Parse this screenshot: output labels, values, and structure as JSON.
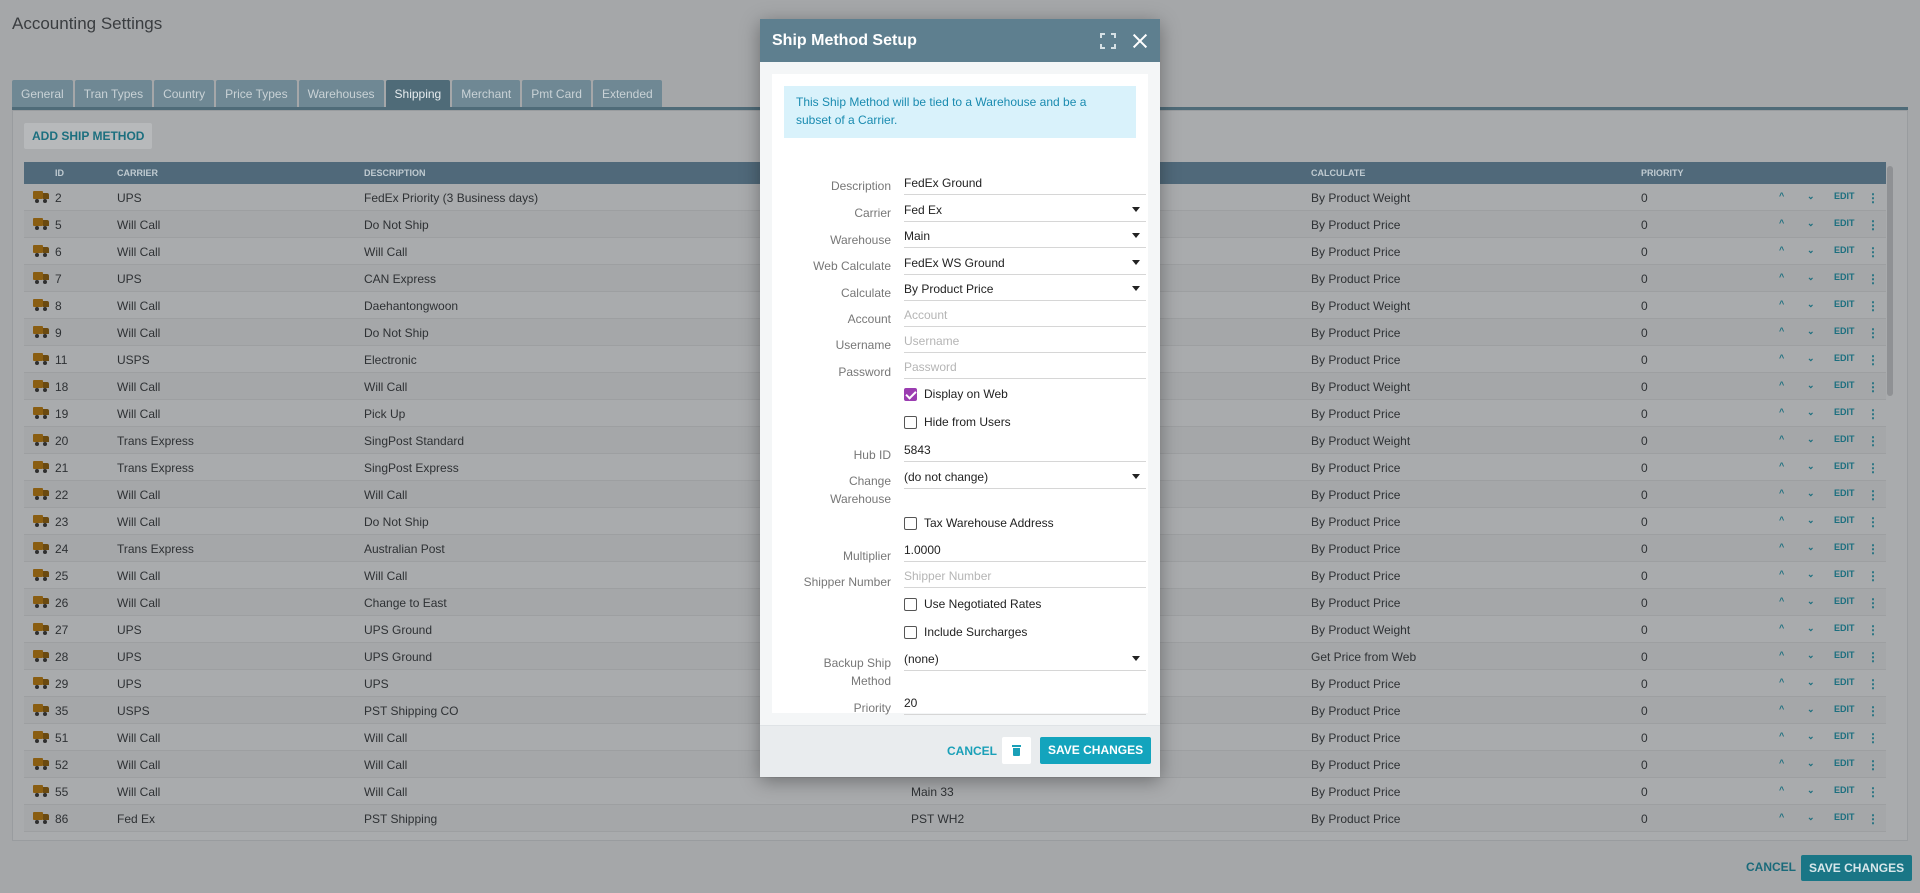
{
  "page": {
    "title": "Accounting Settings",
    "tabs": [
      "General",
      "Tran Types",
      "Country",
      "Price Types",
      "Warehouses",
      "Shipping",
      "Merchant",
      "Pmt Card",
      "Extended"
    ],
    "active_tab": "Shipping",
    "add_button": "ADD SHIP METHOD",
    "columns": {
      "id": "ID",
      "carrier": "CARRIER",
      "description": "DESCRIPTION",
      "calculate": "CALCULATE",
      "priority": "PRIORITY"
    },
    "row_actions": {
      "up": "^",
      "down": "⌄",
      "edit": "EDIT",
      "more": "⋮"
    },
    "rows": [
      {
        "id": "2",
        "carrier": "UPS",
        "description": "FedEx Priority (3 Business days)",
        "warehouse": "",
        "calculate": "By Product Weight",
        "priority": "0"
      },
      {
        "id": "5",
        "carrier": "Will Call",
        "description": "Do Not Ship",
        "warehouse": "",
        "calculate": "By Product Price",
        "priority": "0"
      },
      {
        "id": "6",
        "carrier": "Will Call",
        "description": "Will Call",
        "warehouse": "",
        "calculate": "By Product Price",
        "priority": "0"
      },
      {
        "id": "7",
        "carrier": "UPS",
        "description": "CAN Express",
        "warehouse": "",
        "calculate": "By Product Price",
        "priority": "0"
      },
      {
        "id": "8",
        "carrier": "Will Call",
        "description": "Daehantongwoon",
        "warehouse": "",
        "calculate": "By Product Weight",
        "priority": "0"
      },
      {
        "id": "9",
        "carrier": "Will Call",
        "description": "Do Not Ship",
        "warehouse": "",
        "calculate": "By Product Price",
        "priority": "0"
      },
      {
        "id": "11",
        "carrier": "USPS",
        "description": "Electronic",
        "warehouse": "",
        "calculate": "By Product Price",
        "priority": "0"
      },
      {
        "id": "18",
        "carrier": "Will Call",
        "description": "Will Call",
        "warehouse": "",
        "calculate": "By Product Weight",
        "priority": "0"
      },
      {
        "id": "19",
        "carrier": "Will Call",
        "description": "Pick Up",
        "warehouse": "",
        "calculate": "By Product Price",
        "priority": "0"
      },
      {
        "id": "20",
        "carrier": "Trans Express",
        "description": "SingPost Standard",
        "warehouse": "",
        "calculate": "By Product Weight",
        "priority": "0"
      },
      {
        "id": "21",
        "carrier": "Trans Express",
        "description": "SingPost Express",
        "warehouse": "",
        "calculate": "By Product Price",
        "priority": "0"
      },
      {
        "id": "22",
        "carrier": "Will Call",
        "description": "Will Call",
        "warehouse": "",
        "calculate": "By Product Price",
        "priority": "0"
      },
      {
        "id": "23",
        "carrier": "Will Call",
        "description": "Do Not Ship",
        "warehouse": "",
        "calculate": "By Product Price",
        "priority": "0"
      },
      {
        "id": "24",
        "carrier": "Trans Express",
        "description": "Australian Post",
        "warehouse": "",
        "calculate": "By Product Price",
        "priority": "0"
      },
      {
        "id": "25",
        "carrier": "Will Call",
        "description": "Will Call",
        "warehouse": "",
        "calculate": "By Product Price",
        "priority": "0"
      },
      {
        "id": "26",
        "carrier": "Will Call",
        "description": "Change to East",
        "warehouse": "",
        "calculate": "By Product Price",
        "priority": "0"
      },
      {
        "id": "27",
        "carrier": "UPS",
        "description": "UPS Ground",
        "warehouse": "",
        "calculate": "By Product Weight",
        "priority": "0"
      },
      {
        "id": "28",
        "carrier": "UPS",
        "description": "UPS Ground",
        "warehouse": "",
        "calculate": "Get Price from Web",
        "priority": "0"
      },
      {
        "id": "29",
        "carrier": "UPS",
        "description": "UPS",
        "warehouse": "",
        "calculate": "By Product Price",
        "priority": "0"
      },
      {
        "id": "35",
        "carrier": "USPS",
        "description": "PST Shipping CO",
        "warehouse": "",
        "calculate": "By Product Price",
        "priority": "0"
      },
      {
        "id": "51",
        "carrier": "Will Call",
        "description": "Will Call",
        "warehouse": "",
        "calculate": "By Product Price",
        "priority": "0"
      },
      {
        "id": "52",
        "carrier": "Will Call",
        "description": "Will Call",
        "warehouse": "",
        "calculate": "By Product Price",
        "priority": "0"
      },
      {
        "id": "55",
        "carrier": "Will Call",
        "description": "Will Call",
        "warehouse": "Main 33",
        "calculate": "By Product Price",
        "priority": "0"
      },
      {
        "id": "86",
        "carrier": "Fed Ex",
        "description": "PST Shipping",
        "warehouse": "PST WH2",
        "calculate": "By Product Price",
        "priority": "0"
      }
    ],
    "cancel": "CANCEL",
    "save": "SAVE CHANGES"
  },
  "modal": {
    "title": "Ship Method Setup",
    "info": "This Ship Method will be tied to a Warehouse and be a subset of a Carrier.",
    "fields": {
      "description": {
        "label": "Description",
        "value": "FedEx Ground"
      },
      "carrier": {
        "label": "Carrier",
        "value": "Fed Ex"
      },
      "warehouse": {
        "label": "Warehouse",
        "value": "Main"
      },
      "web_calculate": {
        "label": "Web Calculate",
        "value": "FedEx WS Ground"
      },
      "calculate": {
        "label": "Calculate",
        "value": "By Product Price"
      },
      "account": {
        "label": "Account",
        "placeholder": "Account"
      },
      "username": {
        "label": "Username",
        "placeholder": "Username"
      },
      "password": {
        "label": "Password",
        "placeholder": "Password"
      },
      "hub_id": {
        "label": "Hub ID",
        "value": "5843"
      },
      "change_warehouse": {
        "label_line1": "Change",
        "label_line2": "Warehouse",
        "value": "(do not change)"
      },
      "multiplier": {
        "label": "Multiplier",
        "value": "1.0000"
      },
      "shipper_number": {
        "label": "Shipper Number",
        "placeholder": "Shipper Number"
      },
      "backup_ship_method": {
        "label_line1": "Backup Ship",
        "label_line2": "Method",
        "value": "(none)"
      },
      "priority": {
        "label": "Priority",
        "value": "20"
      }
    },
    "checkboxes": {
      "display_on_web": {
        "label": "Display on Web",
        "checked": true
      },
      "hide_from_users": {
        "label": "Hide from Users",
        "checked": false
      },
      "tax_warehouse_address": {
        "label": "Tax Warehouse Address",
        "checked": false
      },
      "use_negotiated_rates": {
        "label": "Use Negotiated Rates",
        "checked": false
      },
      "include_surcharges": {
        "label": "Include Surcharges",
        "checked": false
      }
    },
    "cancel": "CANCEL",
    "save": "SAVE CHANGES",
    "colors": {
      "header": "#5e7f8f",
      "accent": "#13a4bd",
      "checkbox_checked": "#9b3db1",
      "info_bg": "#d9f2fb"
    }
  }
}
